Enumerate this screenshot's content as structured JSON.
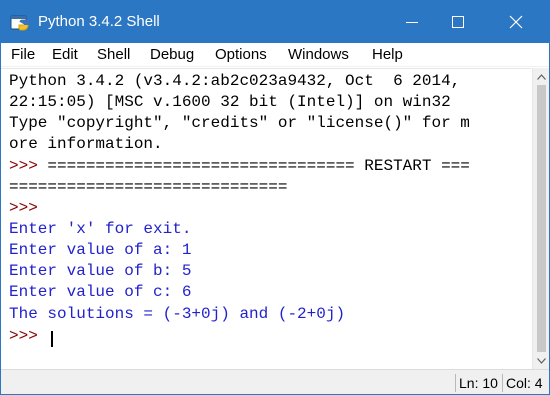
{
  "window": {
    "title": "Python 3.4.2 Shell",
    "accent_color": "#2b77c4",
    "icon": "python-icon"
  },
  "titlebar_buttons": {
    "minimize": "minimize-icon",
    "maximize": "maximize-icon",
    "close": "close-icon"
  },
  "menu": {
    "items": [
      "File",
      "Edit",
      "Shell",
      "Debug",
      "Options",
      "Windows",
      "Help"
    ]
  },
  "shell": {
    "colors": {
      "output": "#000000",
      "prompt": "#8b0000",
      "user_output": "#2222cc"
    },
    "lines": [
      {
        "text": "Python 3.4.2 (v3.4.2:ab2c023a9432, Oct  6 2014,",
        "kind": "output"
      },
      {
        "text": "22:15:05) [MSC v.1600 32 bit (Intel)] on win32",
        "kind": "output"
      },
      {
        "text": "Type \"copyright\", \"credits\" or \"license()\" for m",
        "kind": "output"
      },
      {
        "text": "ore information.",
        "kind": "output"
      },
      {
        "prompt": ">>> ",
        "text": "================================ RESTART ===",
        "kind": "restart"
      },
      {
        "text": "=============================",
        "kind": "output"
      },
      {
        "prompt": ">>>",
        "text": "",
        "kind": "prompt"
      },
      {
        "text": "Enter 'x' for exit.",
        "kind": "user_output"
      },
      {
        "text": "Enter value of a: 1",
        "kind": "user_output"
      },
      {
        "text": "Enter value of b: 5",
        "kind": "user_output"
      },
      {
        "text": "Enter value of c: 6",
        "kind": "user_output"
      },
      {
        "text": "The solutions = (-3+0j) and (-2+0j)",
        "kind": "user_output"
      },
      {
        "prompt": ">>> ",
        "text": "",
        "kind": "prompt"
      }
    ]
  },
  "status": {
    "line": "Ln: 10",
    "column": "Col: 4"
  }
}
